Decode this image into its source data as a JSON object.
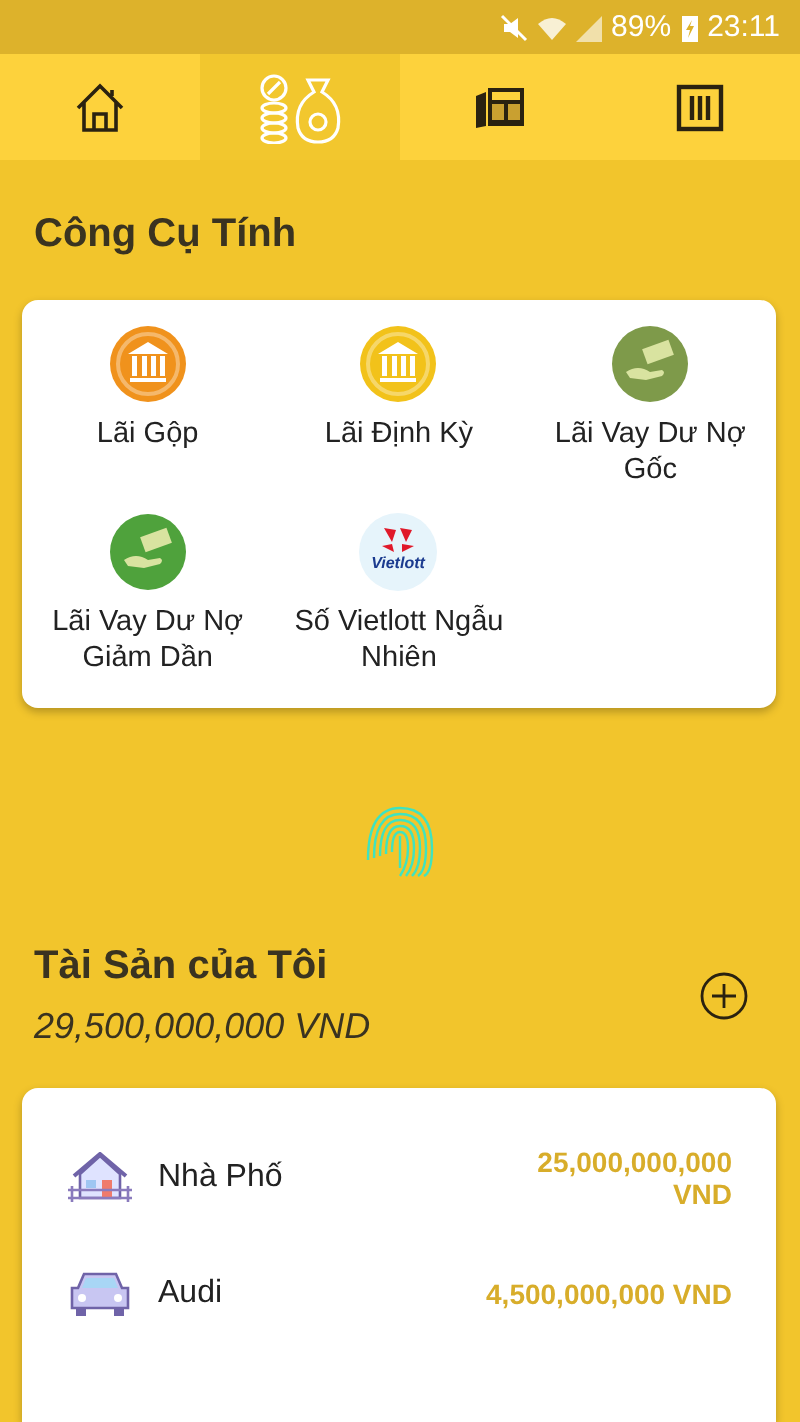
{
  "status_bar": {
    "battery": "89%",
    "time": "23:11"
  },
  "tabs": [
    {
      "kind": "home",
      "selected": false
    },
    {
      "kind": "coins",
      "selected": true
    },
    {
      "kind": "newspaper",
      "selected": false
    },
    {
      "kind": "menu",
      "selected": false
    }
  ],
  "tools": {
    "title": "Công Cụ Tính",
    "items": [
      {
        "label": "Lãi Gộp",
        "kind": "bank",
        "color": "#f0921c"
      },
      {
        "label": "Lãi Định Kỳ",
        "kind": "bank",
        "color": "#f2c21a"
      },
      {
        "label": "Lãi Vay Dư Nợ Gốc",
        "kind": "cash",
        "color": "#7e9a4a"
      },
      {
        "label": "Lãi Vay Dư Nợ Giảm Dần",
        "kind": "cash",
        "color": "#4fa23c"
      },
      {
        "label": "Số Vietlott Ngẫu Nhiên",
        "kind": "lottery",
        "logo_text": "Vietlott"
      }
    ]
  },
  "assets": {
    "title": "Tài Sản của Tôi",
    "total": "29,500,000,000 VND",
    "items": [
      {
        "name": "Nhà Phố",
        "kind": "house",
        "value": "25,000,000,000 VND"
      },
      {
        "name": "Audi",
        "kind": "car",
        "value": "4,500,000,000 VND"
      }
    ]
  }
}
